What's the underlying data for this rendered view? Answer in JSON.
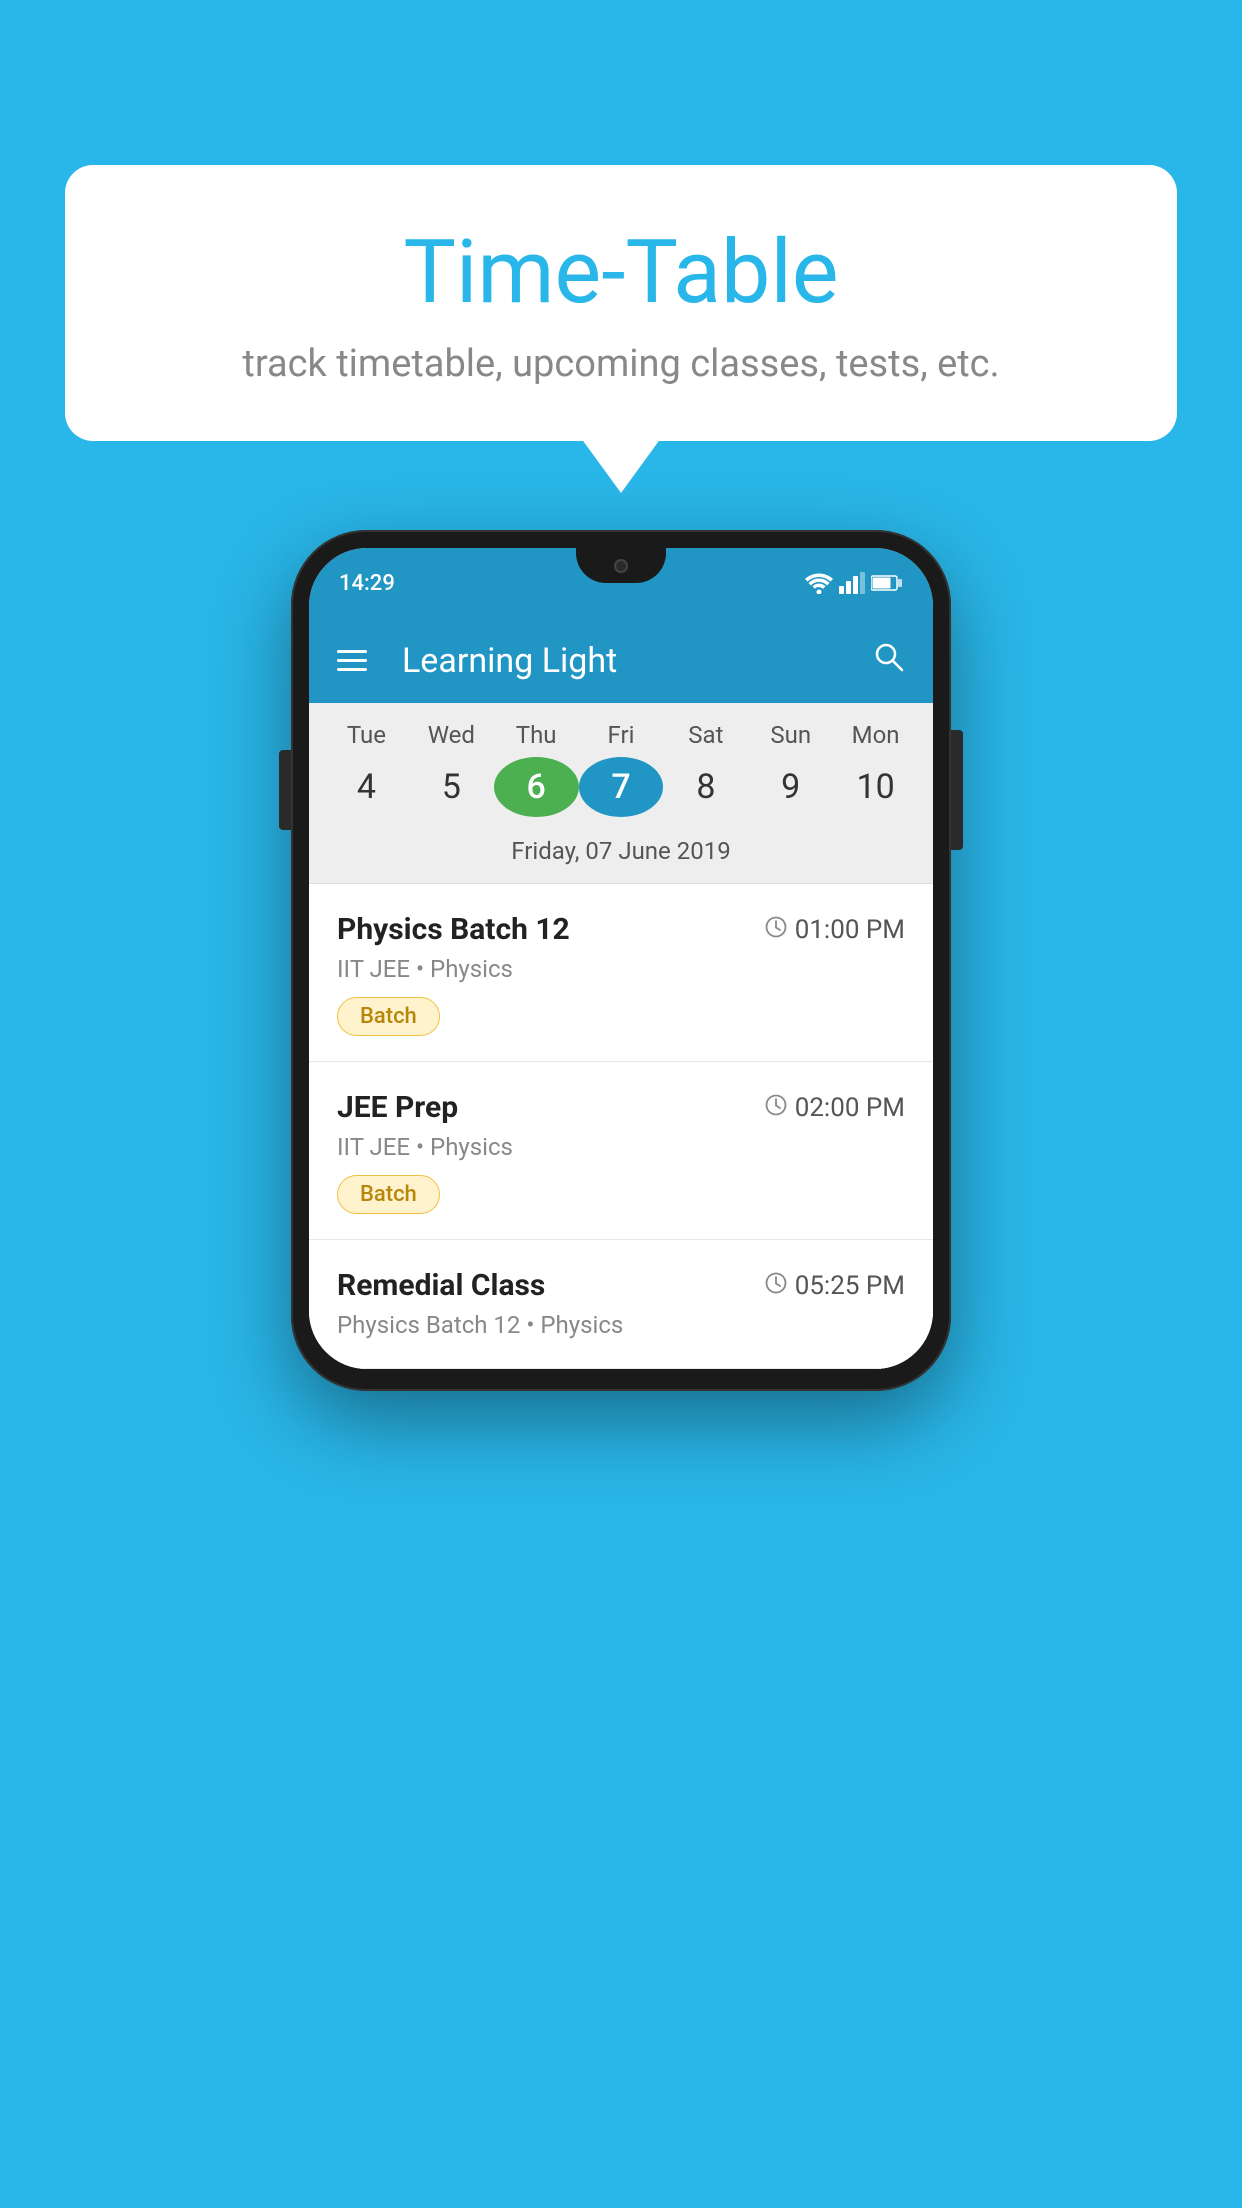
{
  "page": {
    "background_color": "#29B6E8"
  },
  "speech_bubble": {
    "title": "Time-Table",
    "subtitle": "track timetable, upcoming classes, tests, etc."
  },
  "phone": {
    "status_bar": {
      "time": "14:29",
      "icons": [
        "wifi",
        "signal",
        "battery"
      ]
    },
    "app_bar": {
      "title": "Learning Light",
      "menu_icon": "hamburger",
      "search_icon": "search"
    },
    "calendar": {
      "days": [
        {
          "name": "Tue",
          "num": "4",
          "state": "normal"
        },
        {
          "name": "Wed",
          "num": "5",
          "state": "normal"
        },
        {
          "name": "Thu",
          "num": "6",
          "state": "today"
        },
        {
          "name": "Fri",
          "num": "7",
          "state": "selected"
        },
        {
          "name": "Sat",
          "num": "8",
          "state": "normal"
        },
        {
          "name": "Sun",
          "num": "9",
          "state": "normal"
        },
        {
          "name": "Mon",
          "num": "10",
          "state": "normal"
        }
      ],
      "selected_date_label": "Friday, 07 June 2019"
    },
    "schedule": [
      {
        "title": "Physics Batch 12",
        "time": "01:00 PM",
        "meta": "IIT JEE • Physics",
        "tag": "Batch"
      },
      {
        "title": "JEE Prep",
        "time": "02:00 PM",
        "meta": "IIT JEE • Physics",
        "tag": "Batch"
      },
      {
        "title": "Remedial Class",
        "time": "05:25 PM",
        "meta": "Physics Batch 12 • Physics",
        "tag": null
      }
    ]
  }
}
